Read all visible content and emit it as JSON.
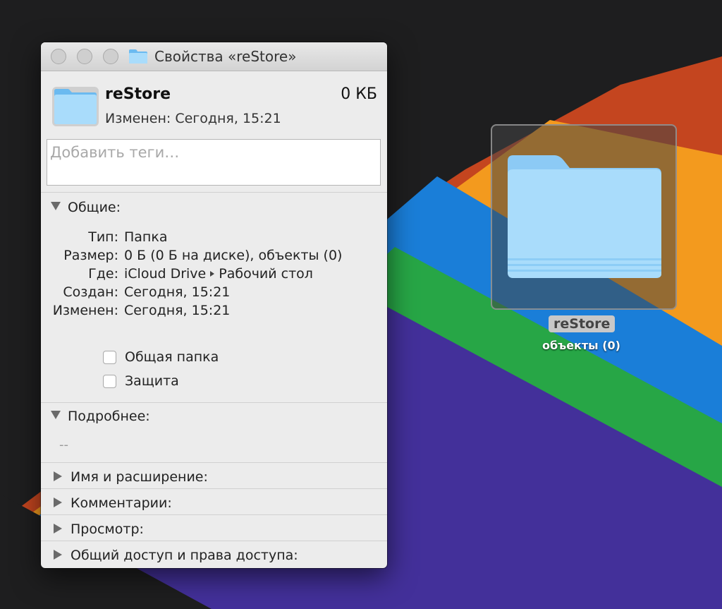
{
  "window": {
    "title": "Свойства «reStore»",
    "name": "reStore",
    "size": "0 КБ",
    "modified_line": "Изменен: Сегодня, 15:21",
    "tags_placeholder": "Добавить теги…"
  },
  "general": {
    "heading": "Общие:",
    "rows": [
      {
        "label": "Тип:",
        "value": "Папка"
      },
      {
        "label": "Размер:",
        "value": "0 Б (0 Б на диске), объекты (0)"
      },
      {
        "label": "Где:",
        "value_a": "iCloud Drive",
        "value_b": "Рабочий стол"
      },
      {
        "label": "Создан:",
        "value": "Сегодня, 15:21"
      },
      {
        "label": "Изменен:",
        "value": "Сегодня, 15:21"
      }
    ],
    "shared_folder": "Общая папка",
    "locked": "Защита"
  },
  "more_info": {
    "heading": "Подробнее:",
    "value": "--"
  },
  "sections": [
    "Имя и расширение:",
    "Комментарии:",
    "Просмотр:",
    "Общий доступ и права доступа:"
  ],
  "desktop": {
    "icon_name": "reStore",
    "icon_subtitle": "объекты (0)"
  },
  "colors": {
    "folder_light": "#a9dcfb",
    "folder_dark": "#6bbaf0",
    "stripe_red": "#c4451f",
    "stripe_orange": "#f39a1e",
    "stripe_blue": "#1a7ed8",
    "stripe_green": "#27a646",
    "stripe_purple": "#43309a"
  }
}
